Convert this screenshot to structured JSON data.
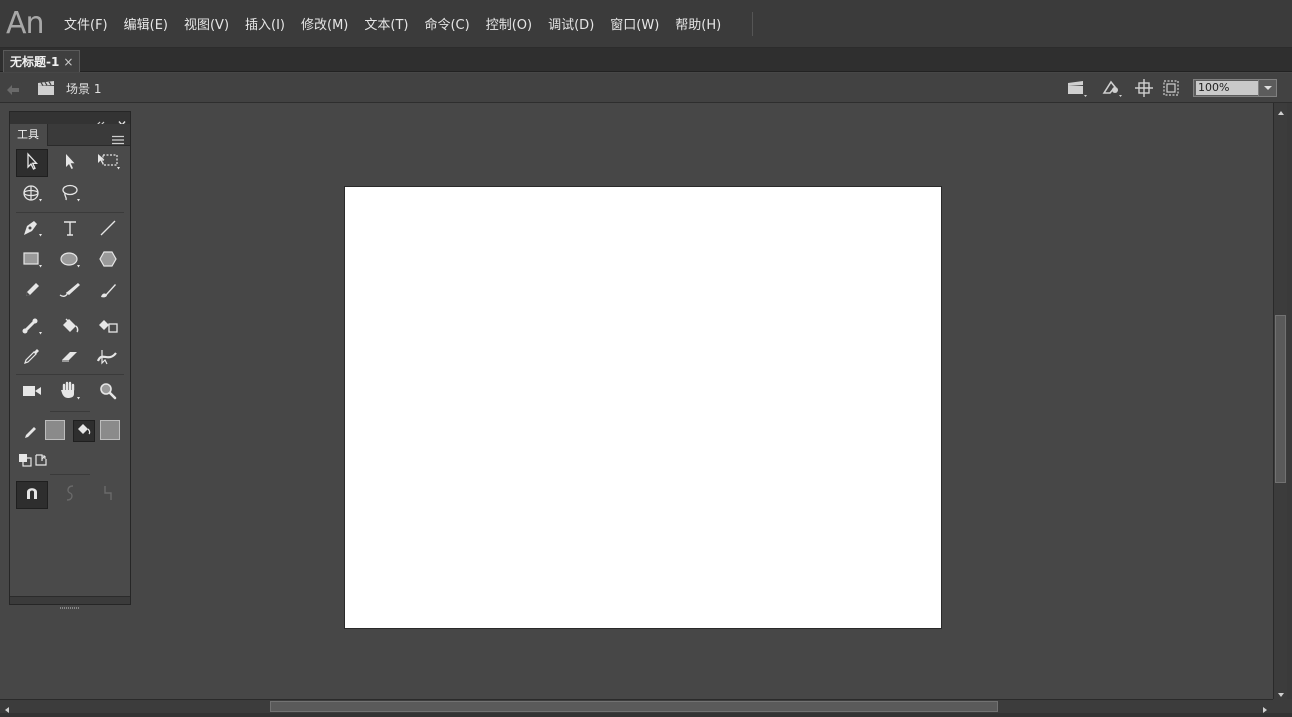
{
  "app": {
    "logo": "An"
  },
  "menu": [
    {
      "label": "文件(F)"
    },
    {
      "label": "编辑(E)"
    },
    {
      "label": "视图(V)"
    },
    {
      "label": "插入(I)"
    },
    {
      "label": "修改(M)"
    },
    {
      "label": "文本(T)"
    },
    {
      "label": "命令(C)"
    },
    {
      "label": "控制(O)"
    },
    {
      "label": "调试(D)"
    },
    {
      "label": "窗口(W)"
    },
    {
      "label": "帮助(H)"
    }
  ],
  "document_tab": {
    "label": "无标题-1",
    "close": "×"
  },
  "edit_bar": {
    "scene_label": "场景 1",
    "zoom": "100%"
  },
  "tools_panel": {
    "title": "工具",
    "tools": [
      {
        "icon": "selection-tool-icon"
      },
      {
        "icon": "subselection-tool-icon"
      },
      {
        "icon": "free-transform-tool-icon"
      },
      {
        "icon": "3d-rotation-tool-icon"
      },
      {
        "icon": "lasso-tool-icon"
      },
      {
        "icon": "pen-tool-icon"
      },
      {
        "icon": "text-tool-icon"
      },
      {
        "icon": "line-tool-icon"
      },
      {
        "icon": "rectangle-tool-icon"
      },
      {
        "icon": "oval-tool-icon"
      },
      {
        "icon": "polystar-tool-icon"
      },
      {
        "icon": "pencil-tool-icon"
      },
      {
        "icon": "paint-brush-tool-icon"
      },
      {
        "icon": "brush-tool-icon"
      },
      {
        "icon": "bone-tool-icon"
      },
      {
        "icon": "paint-bucket-tool-icon"
      },
      {
        "icon": "ink-bottle-tool-icon"
      },
      {
        "icon": "eyedropper-tool-icon"
      },
      {
        "icon": "eraser-tool-icon"
      },
      {
        "icon": "width-tool-icon"
      },
      {
        "icon": "camera-tool-icon"
      },
      {
        "icon": "hand-tool-icon"
      },
      {
        "icon": "zoom-tool-icon"
      }
    ]
  },
  "colors": {
    "stroke_swatch": "#8a8a8a",
    "fill_swatch": "#8a8a8a",
    "stage": "#ffffff",
    "workspace": "#474747"
  }
}
